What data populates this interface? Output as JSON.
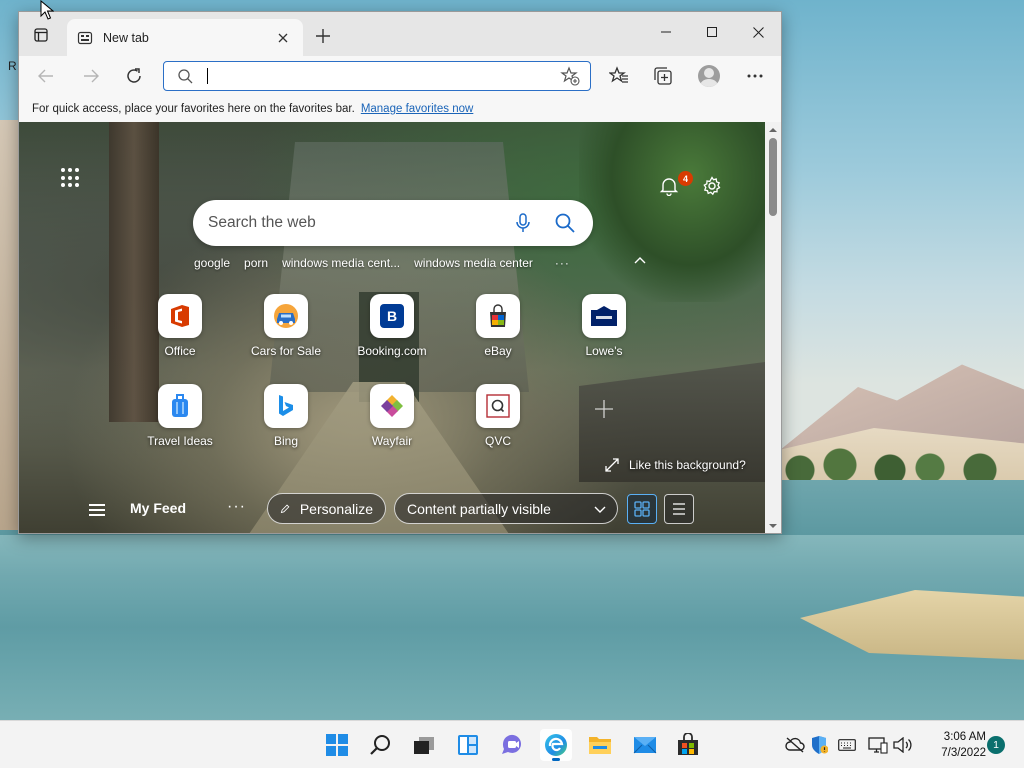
{
  "desktop": {
    "partial_label": "R"
  },
  "browser": {
    "tab": {
      "title": "New tab"
    },
    "favorites_bar": {
      "message": "For quick access, place your favorites here on the favorites bar.",
      "link": "Manage favorites now"
    },
    "address_bar": {
      "value": "",
      "placeholder": ""
    }
  },
  "newtab": {
    "notifications_count": "4",
    "search_placeholder": "Search the web",
    "suggestions": [
      "google",
      "porn",
      "windows media cent...",
      "windows media center"
    ],
    "more_label": "···",
    "quick_links": [
      {
        "label": "Office",
        "icon": "office-icon"
      },
      {
        "label": "Cars for Sale",
        "icon": "car-icon"
      },
      {
        "label": "Booking.com",
        "icon": "booking-icon"
      },
      {
        "label": "eBay",
        "icon": "ebay-icon"
      },
      {
        "label": "Lowe's",
        "icon": "lowes-icon"
      },
      {
        "label": "Travel Ideas",
        "icon": "luggage-icon"
      },
      {
        "label": "Bing",
        "icon": "bing-icon"
      },
      {
        "label": "Wayfair",
        "icon": "wayfair-icon"
      },
      {
        "label": "QVC",
        "icon": "qvc-icon"
      }
    ],
    "like_background": "Like this background?",
    "feed": {
      "title": "My Feed",
      "dots": "···",
      "personalize": "Personalize",
      "visibility": "Content partially visible"
    }
  },
  "taskbar": {
    "apps": [
      "start-icon",
      "search-icon",
      "task-view-icon",
      "widgets-icon",
      "teams-chat-icon",
      "edge-icon",
      "file-explorer-icon",
      "mail-icon",
      "store-icon"
    ],
    "time": "3:06 AM",
    "date": "7/3/2022",
    "notification_count": "1"
  }
}
